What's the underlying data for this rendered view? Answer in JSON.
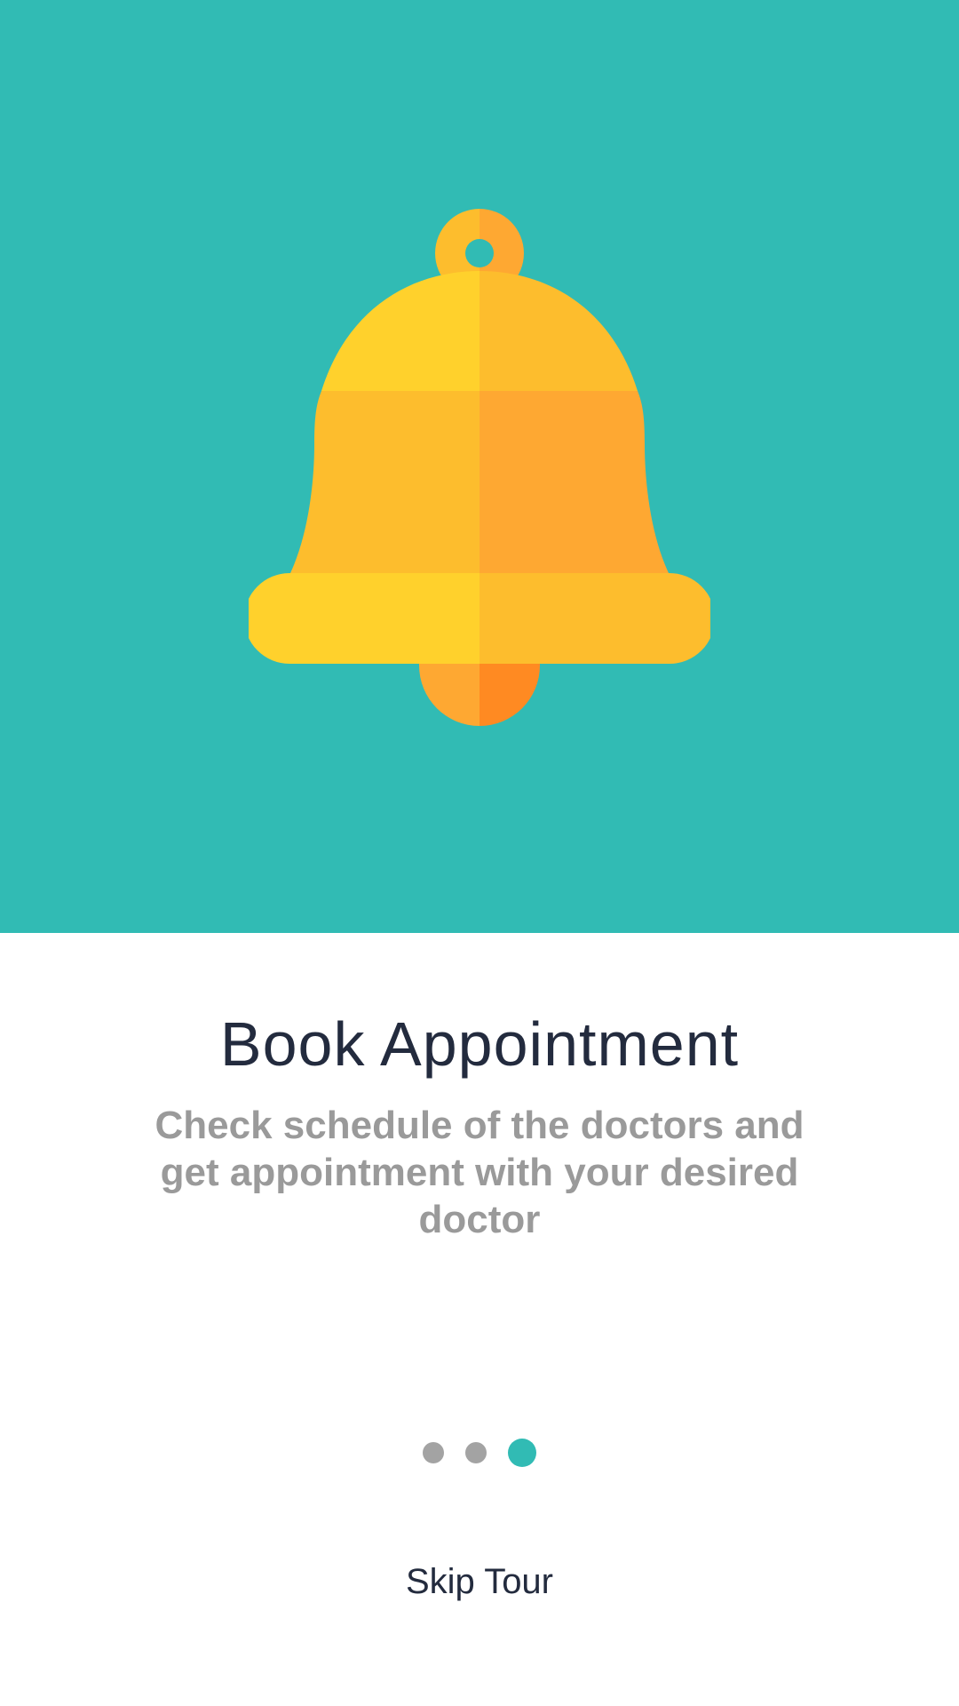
{
  "onboarding": {
    "title": "Book Appointment",
    "description": "Check schedule of the doctors and get appointment with your desired doctor",
    "skip_label": "Skip Tour",
    "illustration": "bell-icon",
    "pagination": {
      "total": 3,
      "active_index": 2
    }
  },
  "colors": {
    "accent": "#31BBB4",
    "title_text": "#232B3E",
    "description_text": "#9A9A9A",
    "dot_inactive": "#A3A3A3"
  }
}
